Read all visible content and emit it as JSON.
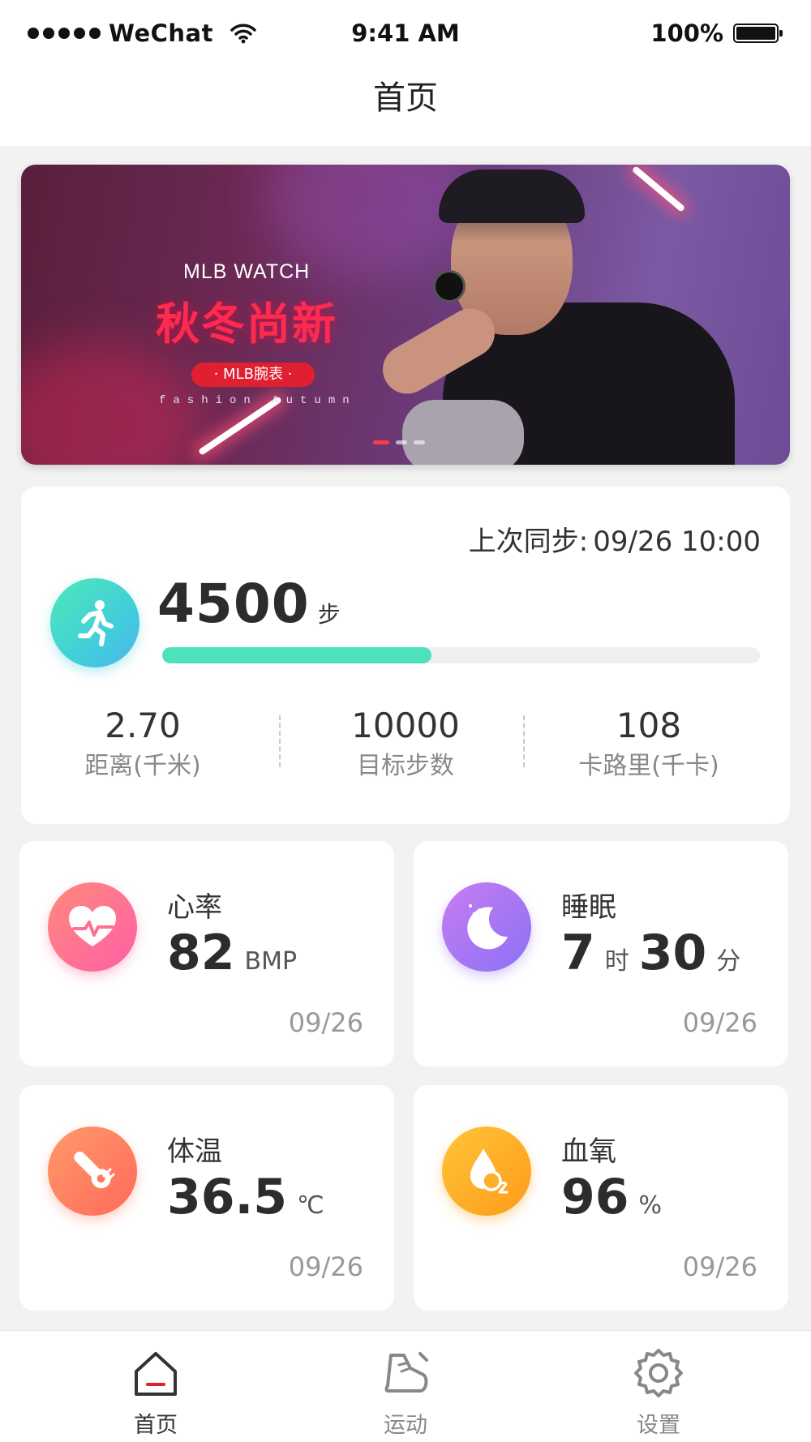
{
  "status_bar": {
    "carrier": "WeChat",
    "time": "9:41 AM",
    "battery": "100%"
  },
  "nav": {
    "title": "首页"
  },
  "banner": {
    "brand": "MLB WATCH",
    "headline": "秋冬尚新",
    "pill": "· MLB腕表 ·",
    "subtitle": "fashion Autumn",
    "active_slide": 1,
    "slide_count": 3
  },
  "steps": {
    "sync_label": "上次同步:",
    "sync_time": "09/26 10:00",
    "count": "4500",
    "unit": "步",
    "progress_percent": 45,
    "stats": [
      {
        "value": "2.70",
        "label": "距离(千米)"
      },
      {
        "value": "10000",
        "label": "目标步数"
      },
      {
        "value": "108",
        "label": "卡路里(千卡)"
      }
    ]
  },
  "metrics": {
    "heart": {
      "title": "心率",
      "value": "82",
      "unit": "BMP",
      "date": "09/26",
      "icon": "heart-rate-icon",
      "colors": [
        "#ff8a7a",
        "#ff5fa8"
      ]
    },
    "sleep": {
      "title": "睡眠",
      "hours": "7",
      "hours_unit": "时",
      "minutes": "30",
      "minutes_unit": "分",
      "date": "09/26",
      "icon": "moon-icon",
      "colors": [
        "#c87cf2",
        "#8a72f5"
      ]
    },
    "temp": {
      "title": "体温",
      "value": "36.5",
      "unit": "℃",
      "date": "09/26",
      "icon": "thermometer-icon",
      "colors": [
        "#ff9a6a",
        "#ff6a5a"
      ]
    },
    "oxygen": {
      "title": "血氧",
      "value": "96",
      "unit": "%",
      "date": "09/26",
      "icon": "oxygen-drop-icon",
      "colors": [
        "#ffc53a",
        "#ff9a1a"
      ]
    }
  },
  "tabs": [
    {
      "label": "首页",
      "icon": "home-icon",
      "active": true
    },
    {
      "label": "运动",
      "icon": "sport-shoe-icon",
      "active": false
    },
    {
      "label": "设置",
      "icon": "gear-icon",
      "active": false
    }
  ]
}
